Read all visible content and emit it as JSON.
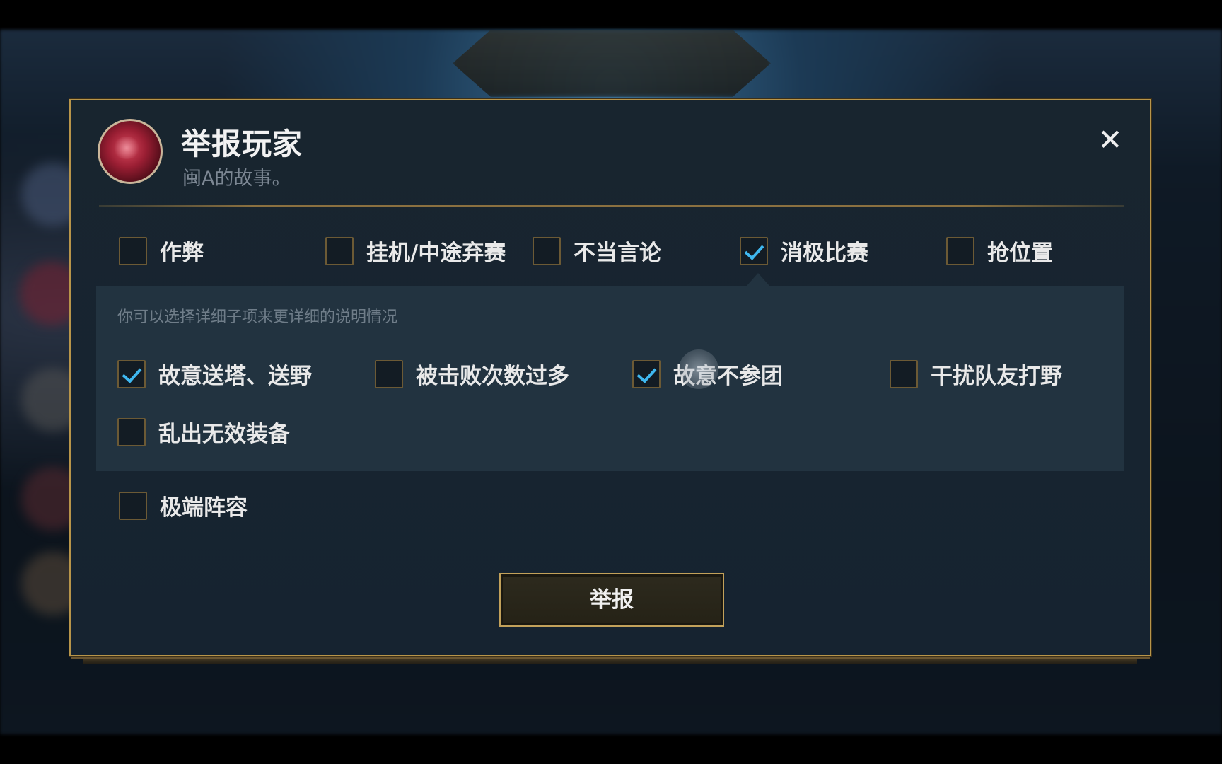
{
  "dialog": {
    "title": "举报玩家",
    "player_name": "闽A的故事。",
    "close_icon": "close-icon",
    "report_button": "举报"
  },
  "categories": [
    {
      "label": "作弊",
      "checked": false
    },
    {
      "label": "挂机/中途弃赛",
      "checked": false
    },
    {
      "label": "不当言论",
      "checked": false
    },
    {
      "label": "消极比赛",
      "checked": true
    },
    {
      "label": "抢位置",
      "checked": false
    }
  ],
  "sub_panel": {
    "hint": "你可以选择详细子项来更详细的说明情况",
    "items": [
      {
        "label": "故意送塔、送野",
        "checked": true
      },
      {
        "label": "被击败次数过多",
        "checked": false
      },
      {
        "label": "故意不参团",
        "checked": true
      },
      {
        "label": "干扰队友打野",
        "checked": false
      },
      {
        "label": "乱出无效装备",
        "checked": false
      }
    ]
  },
  "extra_categories": [
    {
      "label": "极端阵容",
      "checked": false
    }
  ],
  "colors": {
    "accent_gold": "#b8954a",
    "check_blue": "#3fb8f0",
    "panel_bg": "#172430"
  }
}
